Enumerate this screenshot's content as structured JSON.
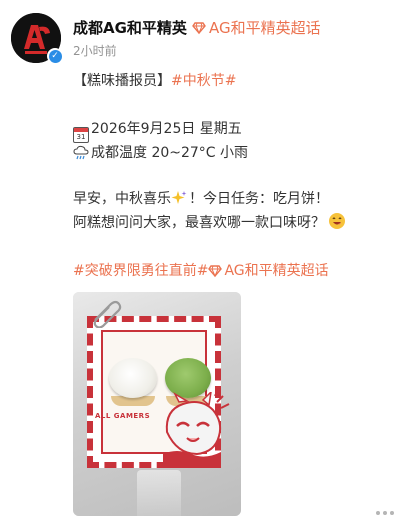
{
  "header": {
    "username": "成都AG和平精英",
    "super_topic_link": "AG和平精英超话",
    "timestamp": "2小时前",
    "verified_badge": "✓"
  },
  "post": {
    "line1_bracket": "【糕味播报员】",
    "line1_tag": "#中秋节#",
    "date_line": "2026年9月25日 星期五",
    "calendar_day": "31",
    "weather_line": "成都温度 20~27°C 小雨",
    "greeting_pre": "早安，中秋喜乐",
    "greeting_post": "！今日任务：吃月饼！",
    "question_line": "阿糕想问问大家，最喜欢哪一款口味呀？",
    "tag_topic": "#突破界限勇往直前#",
    "tag_super": "AG和平精英超话"
  },
  "image": {
    "stamp_text": "ALL GAMERS"
  },
  "colors": {
    "accent": "#eb7350",
    "text": "#333333",
    "muted": "#939393",
    "verified": "#2a8de6",
    "stamp_red": "#c8323a"
  },
  "icons": [
    "avatar-logo",
    "verified-icon",
    "super-topic-gem-icon",
    "calendar-icon",
    "rain-cloud-icon",
    "sparkle-icon",
    "grin-emoji-icon",
    "more-dots-icon"
  ]
}
